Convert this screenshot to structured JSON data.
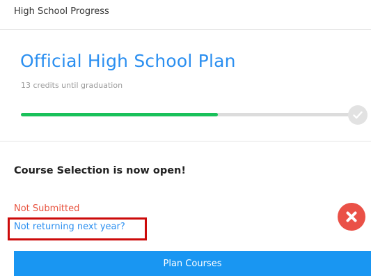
{
  "header": {
    "title": "High School Progress"
  },
  "plan": {
    "title": "Official High School Plan",
    "credits_text": "13 credits until graduation",
    "progress_fraction": 0.595,
    "progress_color": "#19c15a",
    "complete_icon": "checkmark-icon"
  },
  "course_selection": {
    "heading": "Course Selection is now open!",
    "status": "Not Submitted",
    "status_color": "#e8533f",
    "not_returning_link": "Not returning next year?",
    "status_icon": "x-circle-icon",
    "plan_button_label": "Plan Courses"
  },
  "colors": {
    "accent": "#2b8ff0",
    "button": "#1996f2",
    "highlight_border": "#cc0a0a"
  }
}
